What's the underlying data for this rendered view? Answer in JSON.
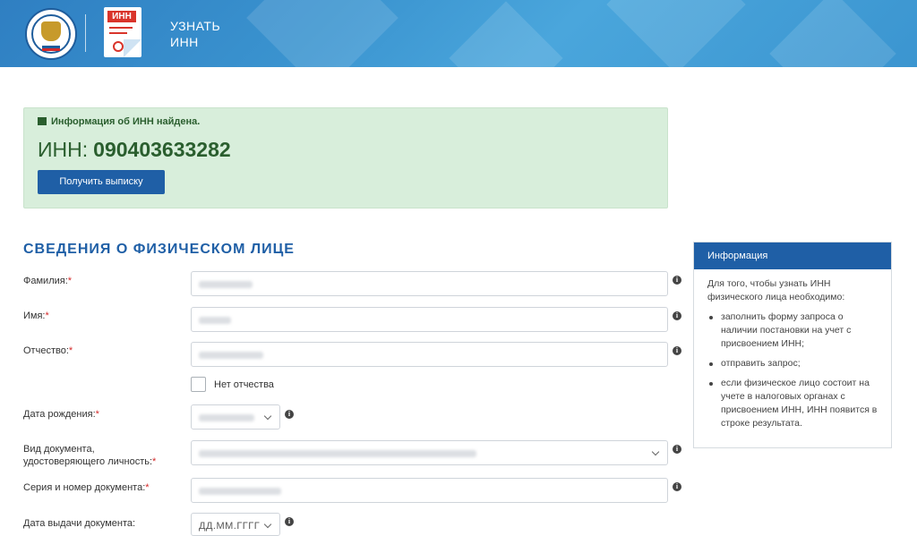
{
  "header": {
    "title_line1": "УЗНАТЬ",
    "title_line2": "ИНН",
    "doc_icon_label": "ИНН",
    "colors": {
      "bg": "#3a93cf"
    }
  },
  "result": {
    "status": "Информация об ИНН найдена.",
    "inn_label": "ИНН:",
    "inn_value": "090403633282",
    "extract_button": "Получить выписку"
  },
  "form": {
    "section_title": "СВЕДЕНИЯ О ФИЗИЧЕСКОМ ЛИЦЕ",
    "surname_label": "Фамилия:",
    "name_label": "Имя:",
    "patronymic_label": "Отчество:",
    "no_patronymic_label": "Нет отчества",
    "birth_date_label": "Дата рождения:",
    "doc_type_label_1": "Вид документа,",
    "doc_type_label_2": "удостоверяющего личность:",
    "doc_number_label": "Серия и номер документа:",
    "doc_issue_date_label": "Дата выдачи документа:",
    "doc_issue_date_placeholder": "ДД.ММ.ГГГГ",
    "required_mark": "*"
  },
  "info_panel": {
    "title": "Информация",
    "intro": "Для того, чтобы узнать ИНН физического лица необходимо:",
    "items": [
      "заполнить форму запроса о наличии постановки на учет с присвоением ИНН;",
      "отправить запрос;",
      "если физическое лицо состоит на учете в налоговых органах с присвоением ИНН, ИНН появится в строке результата."
    ]
  },
  "icons": [
    "emblem-icon",
    "document-icon",
    "gift-icon",
    "info-icon",
    "chevron-down-icon"
  ]
}
